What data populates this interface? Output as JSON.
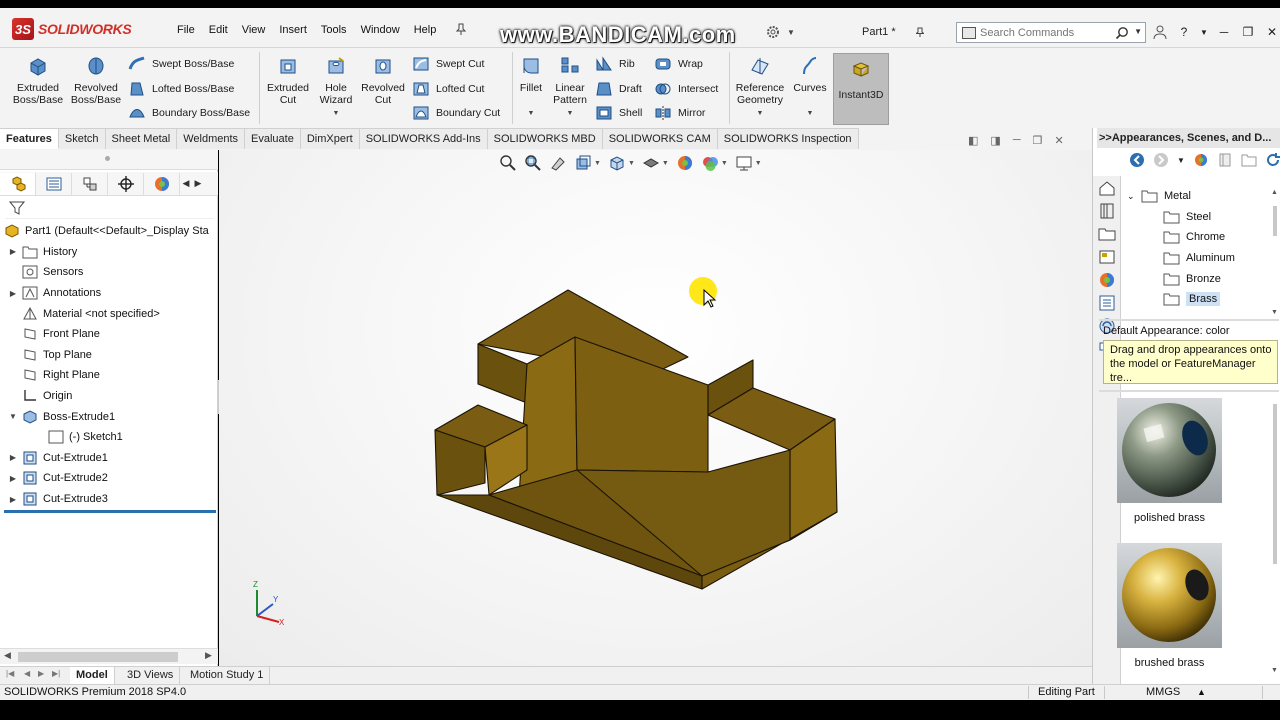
{
  "app": {
    "logo_text": "SOLIDWORKS",
    "watermark": "www.BANDICAM.com",
    "document_title": "Part1 *"
  },
  "menu": [
    "File",
    "Edit",
    "View",
    "Insert",
    "Tools",
    "Window",
    "Help"
  ],
  "search": {
    "placeholder": "Search Commands"
  },
  "toolbar": {
    "extruded_boss": "Extruded Boss/Base",
    "revolved_boss": "Revolved Boss/Base",
    "swept_boss": "Swept Boss/Base",
    "lofted_boss": "Lofted Boss/Base",
    "boundary_boss": "Boundary Boss/Base",
    "extruded_cut": "Extruded Cut",
    "hole_wizard": "Hole Wizard",
    "revolved_cut": "Revolved Cut",
    "swept_cut": "Swept Cut",
    "lofted_cut": "Lofted Cut",
    "boundary_cut": "Boundary Cut",
    "fillet": "Fillet",
    "linear_pattern": "Linear Pattern",
    "rib": "Rib",
    "draft": "Draft",
    "shell": "Shell",
    "wrap": "Wrap",
    "intersect": "Intersect",
    "mirror": "Mirror",
    "reference_geometry": "Reference Geometry",
    "curves": "Curves",
    "instant3d": "Instant3D"
  },
  "tabs": [
    "Features",
    "Sketch",
    "Sheet Metal",
    "Weldments",
    "Evaluate",
    "DimXpert",
    "SOLIDWORKS Add-Ins",
    "SOLIDWORKS MBD",
    "SOLIDWORKS CAM",
    "SOLIDWORKS Inspection"
  ],
  "feature_tree": {
    "root": "Part1  (Default<<Default>_Display Sta",
    "items": [
      {
        "label": "History",
        "expandable": true
      },
      {
        "label": "Sensors",
        "expandable": false
      },
      {
        "label": "Annotations",
        "expandable": true
      },
      {
        "label": "Material <not specified>",
        "expandable": false
      },
      {
        "label": "Front Plane",
        "expandable": false
      },
      {
        "label": "Top Plane",
        "expandable": false
      },
      {
        "label": "Right Plane",
        "expandable": false
      },
      {
        "label": "Origin",
        "expandable": false
      },
      {
        "label": "Boss-Extrude1",
        "expandable": true,
        "expanded": true
      },
      {
        "label": "(-) Sketch1",
        "child": true
      },
      {
        "label": "Cut-Extrude1",
        "expandable": true
      },
      {
        "label": "Cut-Extrude2",
        "expandable": true
      },
      {
        "label": "Cut-Extrude3",
        "expandable": true
      }
    ]
  },
  "triad": {
    "x": "X",
    "y": "Y",
    "z": "Z"
  },
  "model": {
    "color": "#7a5d12"
  },
  "task_pane": {
    "title": ">>Appearances, Scenes, and D...",
    "tree": [
      {
        "label": "Metal",
        "level": 0,
        "expanded": true
      },
      {
        "label": "Steel",
        "level": 1
      },
      {
        "label": "Chrome",
        "level": 1
      },
      {
        "label": "Aluminum",
        "level": 1
      },
      {
        "label": "Bronze",
        "level": 1
      },
      {
        "label": "Brass",
        "level": 1,
        "selected": true
      }
    ],
    "default_appearance": "Default Appearance: color",
    "tip": "Drag and drop appearances onto the model or FeatureManager tre...",
    "swatches": [
      {
        "label": "polished brass"
      },
      {
        "label": "brushed brass"
      }
    ]
  },
  "bottom_tabs": [
    "Model",
    "3D Views",
    "Motion Study 1"
  ],
  "status": {
    "version": "SOLIDWORKS Premium 2018 SP4.0",
    "mode": "Editing Part",
    "units": "MMGS"
  }
}
